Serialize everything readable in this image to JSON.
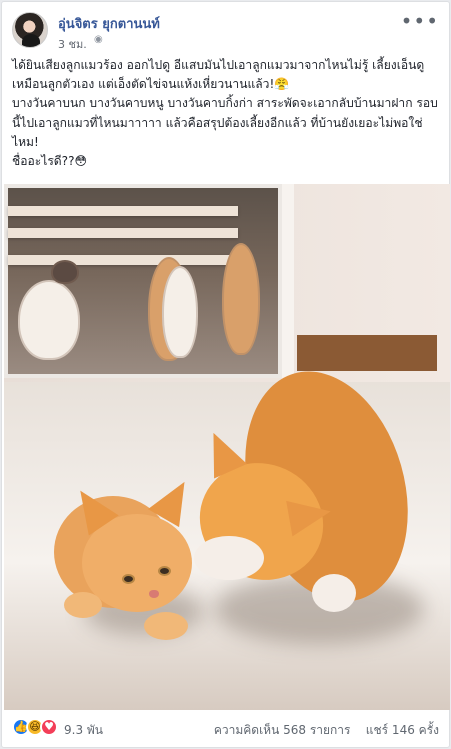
{
  "post": {
    "author": "อุ่นจิตร ยุกตานนท์",
    "time": "3 ชม.",
    "text": "ได้ยินเสียงลูกแมวร้อง ออกไปดู อีแสบมันไปเอาลูกแมวมาจากไหนไม่รู้ เลี้ยงเอ็นดูเหมือนลูกตัวเอง แต่เอ็งตัดไข่จนแห้งเหี่ยวนานแล้ว!😤\nบางวันคาบนก บางวันคาบหนู บางวันคาบกิ้งก่า สาระพัดจะเอากลับบ้านมาฝาก รอบนี้ไปเอาลูกแมวที่ไหนมาาาาา แล้วคือสรุปต้องเลี้ยงอีกแล้ว ที่บ้านยังเยอะไม่พอใช่ไหม!\nชื่ออะไรดี??😳"
  },
  "icons": {
    "privacy": "globe-icon",
    "more": "more-options-icon",
    "reactions": [
      "like-icon",
      "haha-icon",
      "love-icon"
    ]
  },
  "reactions": {
    "count": "9.3 พัน"
  },
  "stats": {
    "comments": "ความคิดเห็น 568 รายการ",
    "shares": "แชร์ 146 ครั้ง"
  },
  "colors": {
    "author": "#385898",
    "like": "#1877f2",
    "haha": "#f7b928",
    "love": "#f33e58"
  }
}
